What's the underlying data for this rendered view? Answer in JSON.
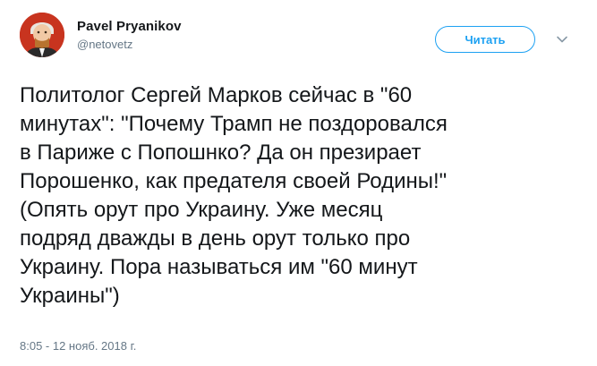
{
  "author": {
    "name": "Pavel Pryanikov",
    "handle": "@netovetz"
  },
  "follow_button": {
    "label": "Читать"
  },
  "menu": {
    "icon": "chevron-down-icon"
  },
  "tweet": {
    "lines": [
      "Политолог Сергей Марков сейчас в \"60",
      "минутах\": \"Почему Трамп не поздоровался",
      "в Париже с Попошнко? Да он презирает",
      "Порошенко, как предателя своей Родины!\"",
      "(Опять орут про Украину. Уже месяц",
      "подряд дважды в день орут только про",
      "Украину. Пора называться им \"60 минут",
      "Украины\")"
    ],
    "timestamp": "8:05 - 12 нояб. 2018 г."
  },
  "colors": {
    "accent": "#1da1f2",
    "secondary_text": "#657786",
    "primary_text": "#14171a",
    "avatar_background": "#c8341f"
  }
}
